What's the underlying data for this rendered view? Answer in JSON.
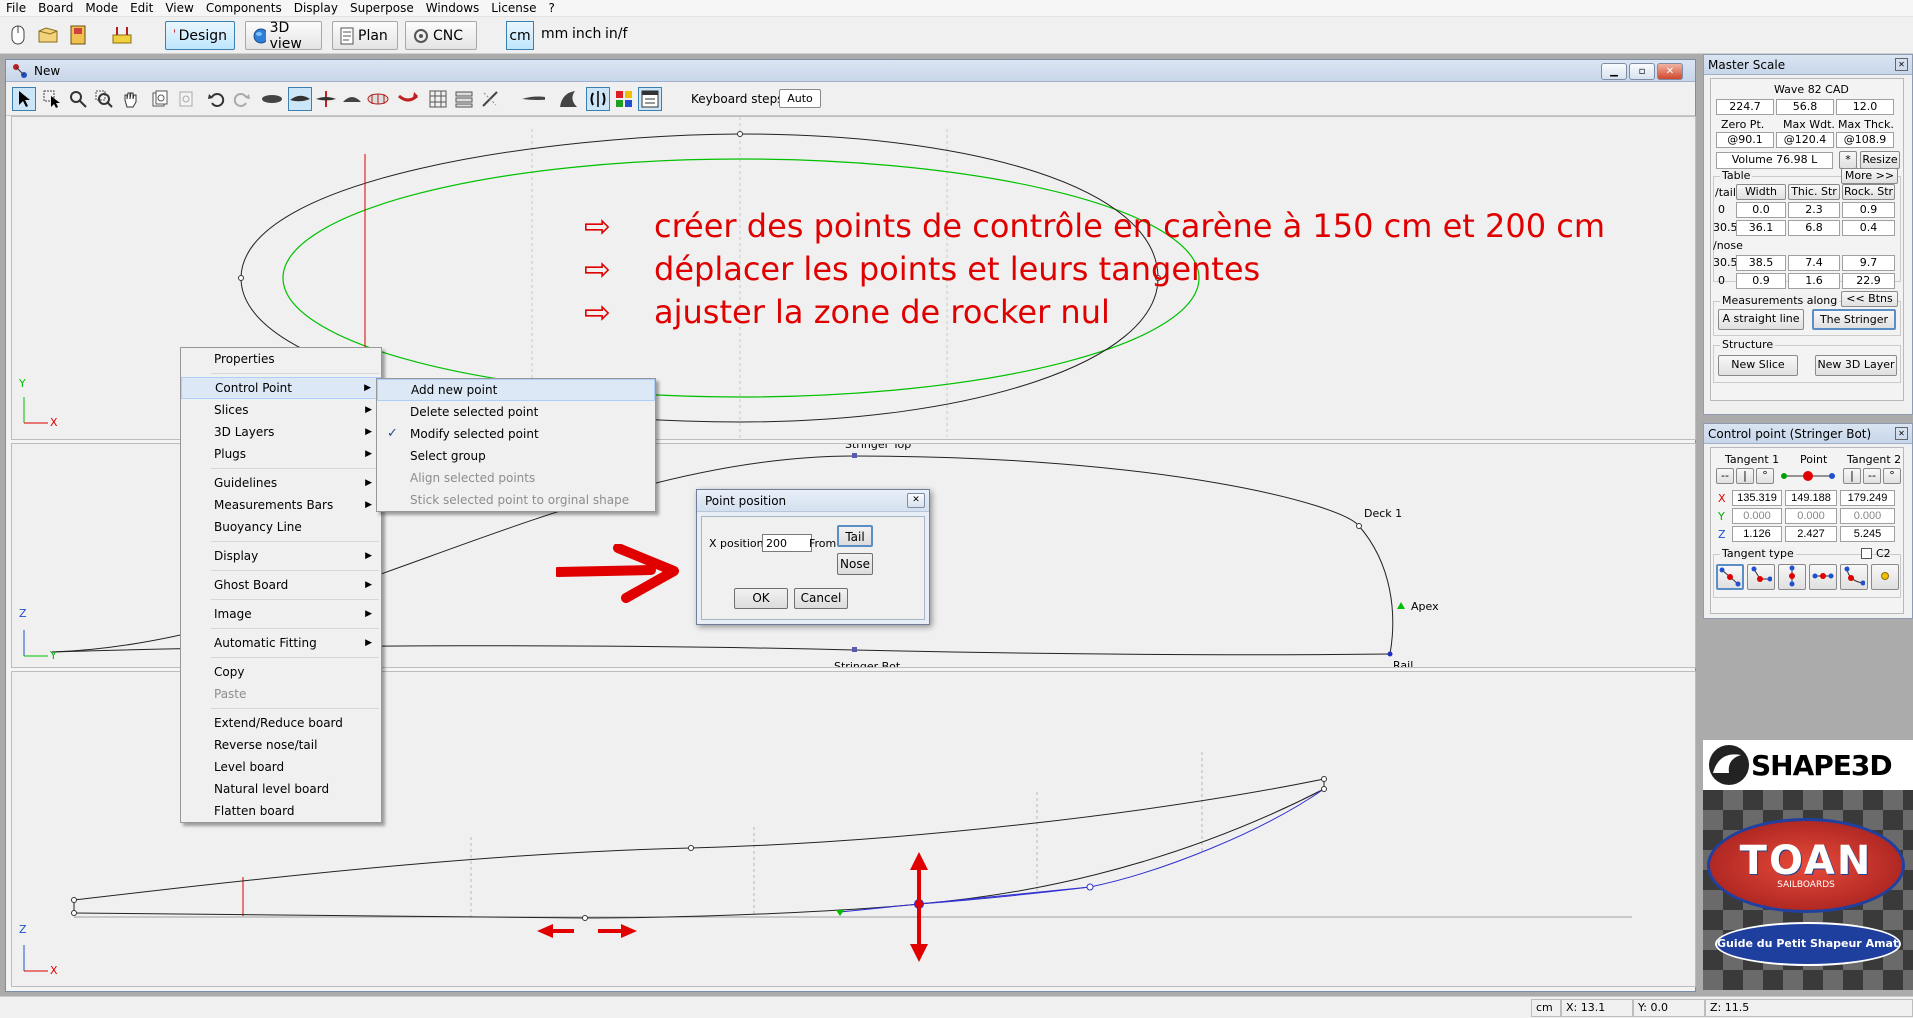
{
  "menu": [
    "File",
    "Board",
    "Mode",
    "Edit",
    "View",
    "Components",
    "Display",
    "Superpose",
    "Windows",
    "License",
    "?"
  ],
  "toolbar": {
    "design": "Design",
    "view3d": "3D view",
    "plan": "Plan",
    "cnc": "CNC",
    "units": [
      "cm",
      "mm",
      "inch",
      "in/f"
    ]
  },
  "window": {
    "title": "New",
    "keyboard_steps_label": "Keyboard steps",
    "auto_label": "Auto"
  },
  "annotations": [
    "créer des points de contrôle en carène à 150 cm et 200 cm",
    "déplacer les points et leurs tangentes",
    "ajuster la zone de rocker nul"
  ],
  "section_labels": {
    "stringer_top": "Stringer Top",
    "stringer_bot": "Stringer Bot",
    "deck": "Deck 1",
    "apex": "Apex",
    "rail": "Rail"
  },
  "axes": {
    "view1": [
      "Y",
      "X"
    ],
    "view2": [
      "Z",
      "Y"
    ],
    "view3": [
      "Z",
      "X"
    ]
  },
  "context_menu": [
    {
      "label": "Properties",
      "submenu": false
    },
    {
      "sep": true
    },
    {
      "label": "Control Point",
      "submenu": true,
      "highlight": true
    },
    {
      "label": "Slices",
      "submenu": true
    },
    {
      "label": "3D Layers",
      "submenu": true
    },
    {
      "label": "Plugs",
      "submenu": true
    },
    {
      "sep": true
    },
    {
      "label": "Guidelines",
      "submenu": true
    },
    {
      "label": "Measurements Bars",
      "submenu": true
    },
    {
      "label": "Buoyancy Line",
      "submenu": false
    },
    {
      "sep": true
    },
    {
      "label": "Display",
      "submenu": true
    },
    {
      "sep": true
    },
    {
      "label": "Ghost Board",
      "submenu": true
    },
    {
      "sep": true
    },
    {
      "label": "Image",
      "submenu": true
    },
    {
      "sep": true
    },
    {
      "label": "Automatic Fitting",
      "submenu": true
    },
    {
      "sep": true
    },
    {
      "label": "Copy",
      "submenu": false
    },
    {
      "label": "Paste",
      "submenu": false,
      "disabled": true
    },
    {
      "sep": true
    },
    {
      "label": "Extend/Reduce board",
      "submenu": false
    },
    {
      "label": "Reverse nose/tail",
      "submenu": false
    },
    {
      "label": "Level board",
      "submenu": false
    },
    {
      "label": "Natural level board",
      "submenu": false
    },
    {
      "label": "Flatten board",
      "submenu": false
    }
  ],
  "submenu": [
    {
      "label": "Add new point",
      "highlight": true
    },
    {
      "label": "Delete selected point"
    },
    {
      "label": "Modify selected point",
      "checked": true
    },
    {
      "label": "Select group"
    },
    {
      "label": "Align selected points",
      "disabled": true
    },
    {
      "label": "Stick selected point to orginal shape",
      "disabled": true
    }
  ],
  "dialog": {
    "title": "Point position",
    "x_label": "X position :",
    "x_value": "200",
    "from_label": "From",
    "tail": "Tail",
    "nose": "Nose",
    "ok": "OK",
    "cancel": "Cancel"
  },
  "master_scale": {
    "title": "Master Scale",
    "board_name": "Wave 82 CAD",
    "dims": [
      "224.7",
      "56.8",
      "12.0"
    ],
    "dim_headers": [
      "Zero Pt.",
      "Max Wdt.",
      "Max Thck."
    ],
    "dim_positions": [
      "@90.1",
      "@120.4",
      "@108.9"
    ],
    "volume": "Volume 76.98 L",
    "star": "*",
    "resize": "Resize",
    "table_label": "Table",
    "more": "More >>",
    "col_headers": [
      "/tail",
      "Width",
      "Thic. Str",
      "Rock. Str"
    ],
    "rows_tail": [
      [
        "0",
        "0.0",
        "2.3",
        "0.9"
      ],
      [
        "30.5",
        "36.1",
        "6.8",
        "0.4"
      ]
    ],
    "nose_label": "/nose",
    "rows_nose": [
      [
        "30.5",
        "38.5",
        "7.4",
        "9.7"
      ],
      [
        "0",
        "0.9",
        "1.6",
        "22.9"
      ]
    ],
    "btns_label": "<< Btns",
    "measurements_label": "Measurements along",
    "straight_line": "A straight line",
    "the_stringer": "The Stringer",
    "structure_label": "Structure",
    "new_slice": "New Slice",
    "new_layer": "New 3D Layer"
  },
  "control_point": {
    "title": "Control point (Stringer Bot)",
    "headers": [
      "Tangent 1",
      "Point",
      "Tangent 2"
    ],
    "x": [
      "135.319",
      "149.188",
      "179.249"
    ],
    "y": [
      "0.000",
      "0.000",
      "0.000"
    ],
    "z": [
      "1.126",
      "2.427",
      "5.245"
    ],
    "axis_labels": [
      "X",
      "Y",
      "Z"
    ],
    "tangent_type": "Tangent type",
    "c2": "C2",
    "t_btn_labels": [
      "--",
      "|",
      "°",
      "|",
      "--",
      "°"
    ]
  },
  "logos": {
    "shape3d": "SHAPE3D",
    "toan": "TOAN",
    "toan_sub": "SAILBOARDS",
    "guide": "Guide du Petit Shapeur Amateur.fr"
  },
  "status": {
    "unit": "cm",
    "x": "X: 13.1",
    "y": "Y: 0.0",
    "z": "Z: 11.5"
  },
  "colors": {
    "annotation_red": "#e00000",
    "outline_green": "#00c000",
    "curve_blue": "#3030d0"
  }
}
